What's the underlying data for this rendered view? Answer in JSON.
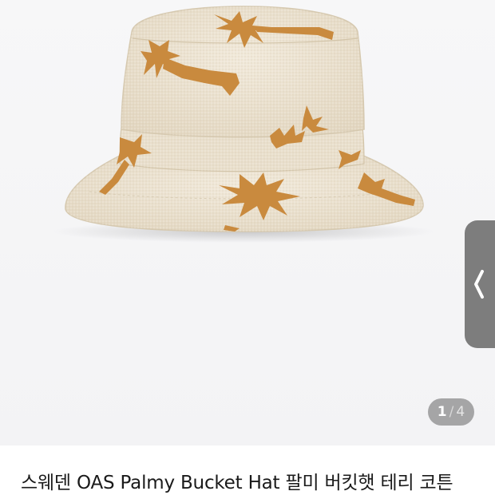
{
  "gallery": {
    "image_alt": "OAS Palmy Bucket Hat terry cotton bucket hat with orange palm print",
    "current_index": "1",
    "separator": "/",
    "total": "4",
    "side_tab_icon": "chevron-left-icon"
  },
  "product": {
    "title": "스웨덴 OAS Palmy Bucket Hat 팔미 버킷햇 테리 코튼"
  },
  "colors": {
    "hat_terry": "#ece3d2",
    "palm_print": "#c98a3e",
    "side_tab": "#7d7d7d",
    "background": "#f5f5f6"
  }
}
